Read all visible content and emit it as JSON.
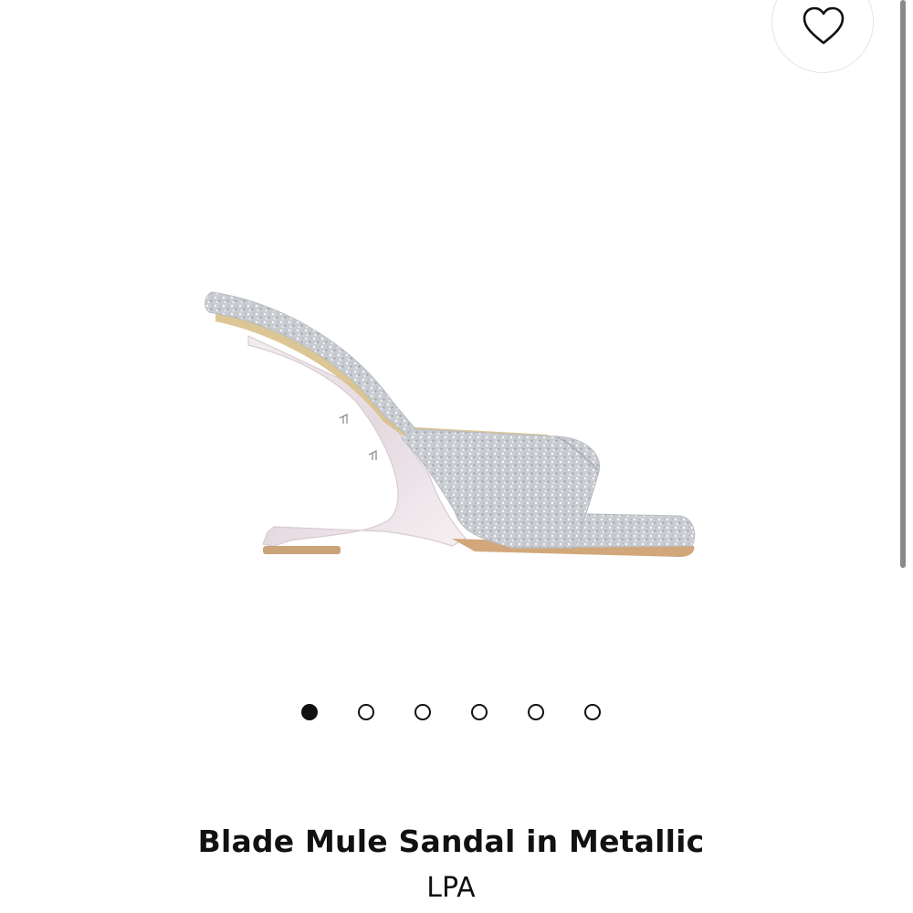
{
  "favorite": {
    "icon": "heart-outline-icon"
  },
  "gallery": {
    "image_alt": "Blade Mule Sandal in Metallic",
    "total_slides": 6,
    "active_slide": 1
  },
  "product": {
    "title": "Blade Mule Sandal in Metallic",
    "brand": "LPA"
  },
  "colors": {
    "text": "#111111",
    "dot": "#111111",
    "sparkle": "#c8ccd2"
  }
}
